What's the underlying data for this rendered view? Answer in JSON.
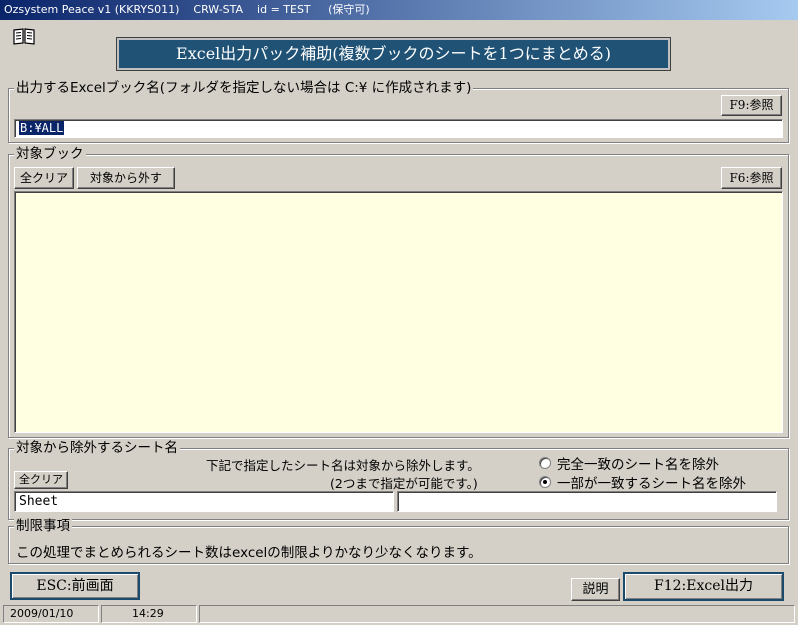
{
  "window": {
    "title": "Ozsystem Peace v1 (KKRYS011)    CRW-STA    id = TEST     (保守可)"
  },
  "header": {
    "banner": "Excel出力パック補助(複数ブックのシートを1つにまとめる)"
  },
  "output_book": {
    "legend": "出力するExcelブック名(フォルダを指定しない場合は C:¥ に作成されます)",
    "browse_label": "F9:参照",
    "path_value": "B:¥ALL"
  },
  "target_books": {
    "legend": "対象ブック",
    "clear_all_label": "全クリア",
    "remove_label": "対象から外す",
    "browse_label": "F6:参照",
    "items": []
  },
  "exclude_sheets": {
    "legend": "対象から除外するシート名",
    "clear_all_label": "全クリア",
    "note_line1": "下記で指定したシート名は対象から除外します。",
    "note_line2": "(2つまで指定が可能です。)",
    "field1_value": "Sheet",
    "field2_value": "",
    "option_exact": "完全一致のシート名を除外",
    "option_partial": "一部が一致するシート名を除外",
    "selected_option": "partial"
  },
  "restrictions": {
    "legend": "制限事項",
    "text": "この処理でまとめられるシート数はexcelの制限よりかなり少なくなります。"
  },
  "footer": {
    "back_label": "ESC:前画面",
    "help_label": "説明",
    "export_label": "F12:Excel出力"
  },
  "statusbar": {
    "date": "2009/01/10",
    "time": "14:29",
    "message": ""
  }
}
